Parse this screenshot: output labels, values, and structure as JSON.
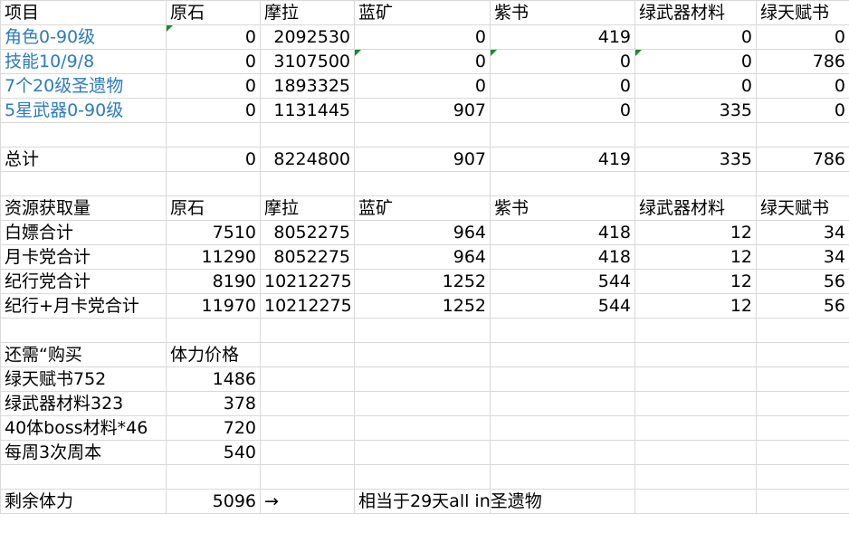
{
  "colors": {
    "link": "#2b7bbf",
    "grid": "#d9d9d9",
    "flag": "#1a8a2a"
  },
  "header": [
    "项目",
    "原石",
    "摩拉",
    "蓝矿",
    "紫书",
    "绿武器材料",
    "绿天赋书"
  ],
  "req_rows": [
    [
      "角色0-90级",
      "0",
      "2092530",
      "0",
      "419",
      "0",
      "0"
    ],
    [
      "技能10/9/8",
      "0",
      "3107500",
      "0",
      "0",
      "0",
      "786"
    ],
    [
      "7个20级圣遗物",
      "0",
      "1893325",
      "0",
      "0",
      "0",
      "0"
    ],
    [
      "5星武器0-90级",
      "0",
      "1131445",
      "907",
      "0",
      "335",
      "0"
    ]
  ],
  "total_row": [
    "总计",
    "0",
    "8224800",
    "907",
    "419",
    "335",
    "786"
  ],
  "gain_header": [
    "资源获取量",
    "原石",
    "摩拉",
    "蓝矿",
    "紫书",
    "绿武器材料",
    "绿天赋书"
  ],
  "gain_rows": [
    [
      "白嫖合计",
      "7510",
      "8052275",
      "964",
      "418",
      "12",
      "34"
    ],
    [
      "月卡党合计",
      "11290",
      "8052275",
      "964",
      "418",
      "12",
      "34"
    ],
    [
      "纪行党合计",
      "8190",
      "10212275",
      "1252",
      "544",
      "12",
      "56"
    ],
    [
      "纪行+月卡党合计",
      "11970",
      "10212275",
      "1252",
      "544",
      "12",
      "56"
    ]
  ],
  "buy_header": [
    "还需“购买",
    "体力价格"
  ],
  "buy_rows": [
    [
      "绿天赋书752",
      "1486"
    ],
    [
      "绿武器材料323",
      "378"
    ],
    [
      "40体boss材料*46",
      "720"
    ],
    [
      "每周3次周本",
      "540"
    ]
  ],
  "remain": {
    "label": "剩余体力",
    "value": "5096",
    "arrow": "→",
    "note": "相当于29天all in圣遗物"
  }
}
